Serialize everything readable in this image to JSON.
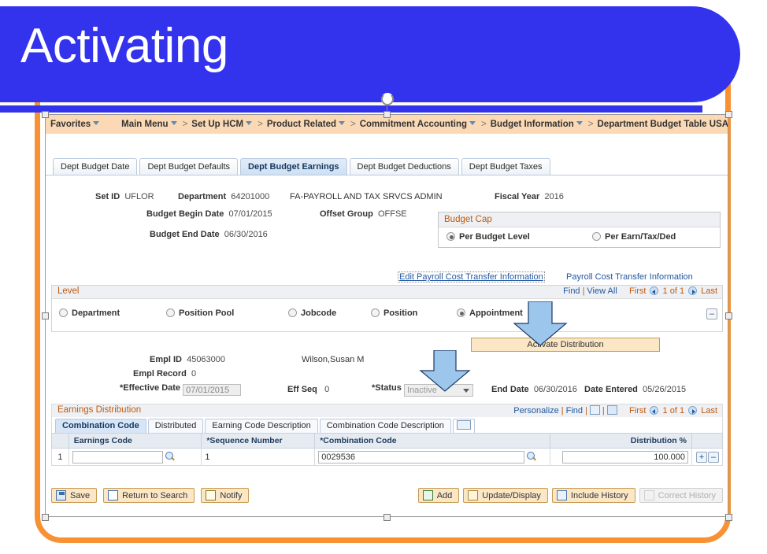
{
  "slide": {
    "title": "Activating",
    "banner_color": "#3333EE",
    "frame_color": "#F79134"
  },
  "breadcrumb": {
    "favorites": "Favorites",
    "items": [
      {
        "label": "Main Menu",
        "has_caret": true
      },
      {
        "label": "Set Up HCM",
        "has_caret": true
      },
      {
        "label": "Product Related",
        "has_caret": true
      },
      {
        "label": "Commitment Accounting",
        "has_caret": true
      },
      {
        "label": "Budget Information",
        "has_caret": true
      },
      {
        "label": "Department Budget Table USA",
        "has_caret": false
      }
    ]
  },
  "tabs": [
    {
      "label": "Dept Budget Date",
      "active": false
    },
    {
      "label": "Dept Budget Defaults",
      "active": false
    },
    {
      "label": "Dept Budget Earnings",
      "active": true
    },
    {
      "label": "Dept Budget Deductions",
      "active": false
    },
    {
      "label": "Dept Budget Taxes",
      "active": false
    }
  ],
  "header": {
    "set_id_label": "Set ID",
    "set_id_value": "UFLOR",
    "department_label": "Department",
    "department_value": "64201000",
    "department_name": "FA-PAYROLL AND TAX SRVCS ADMIN",
    "fiscal_year_label": "Fiscal Year",
    "fiscal_year_value": "2016",
    "budget_begin_label": "Budget Begin Date",
    "budget_begin_value": "07/01/2015",
    "offset_group_label": "Offset Group",
    "offset_group_value": "OFFSE",
    "budget_end_label": "Budget End Date",
    "budget_end_value": "06/30/2016"
  },
  "budget_cap": {
    "title": "Budget Cap",
    "options": [
      {
        "label": "Per Budget Level",
        "selected": true
      },
      {
        "label": "Per Earn/Tax/Ded",
        "selected": false
      }
    ]
  },
  "links": {
    "edit_payroll_cost_transfer": "Edit Payroll Cost Transfer Information",
    "payroll_cost_transfer": "Payroll Cost Transfer Information"
  },
  "level": {
    "title": "Level",
    "nav": {
      "find": "Find",
      "view_all": "View All",
      "first": "First",
      "counter": "1 of 1",
      "last": "Last"
    },
    "options": [
      {
        "label": "Department",
        "selected": false
      },
      {
        "label": "Position Pool",
        "selected": false
      },
      {
        "label": "Jobcode",
        "selected": false
      },
      {
        "label": "Position",
        "selected": false
      },
      {
        "label": "Appointment",
        "selected": true
      }
    ],
    "collapse_glyph": "–"
  },
  "activate_button": {
    "label": "Activate Distribution"
  },
  "employee": {
    "empl_id_label": "Empl ID",
    "empl_id_value": "45063000",
    "name": "Wilson,Susan M",
    "empl_record_label": "Empl Record",
    "empl_record_value": "0",
    "effective_date_label": "*Effective Date",
    "effective_date_value": "07/01/2015",
    "eff_seq_label": "Eff Seq",
    "eff_seq_value": "0",
    "status_label": "*Status",
    "status_value": "Inactive",
    "end_date_label": "End Date",
    "end_date_value": "06/30/2016",
    "date_entered_label": "Date Entered",
    "date_entered_value": "05/26/2015"
  },
  "earnings_distribution": {
    "title": "Earnings Distribution",
    "nav": {
      "personalize": "Personalize",
      "find": "Find",
      "first": "First",
      "counter": "1 of 1",
      "last": "Last"
    },
    "tabs": [
      {
        "label": "Combination Code",
        "active": true
      },
      {
        "label": "Distributed",
        "active": false
      },
      {
        "label": "Earning Code Description",
        "active": false
      },
      {
        "label": "Combination Code Description",
        "active": false
      }
    ],
    "columns": [
      "Earnings Code",
      "*Sequence Number",
      "*Combination Code",
      "Distribution %"
    ],
    "rows": [
      {
        "index": "1",
        "earnings_code": "",
        "sequence_number": "1",
        "combination_code": "0029536",
        "distribution_pct": "100.000",
        "add_glyph": "+",
        "remove_glyph": "–"
      }
    ]
  },
  "toolbar": {
    "left": [
      {
        "label": "Save",
        "icon": "save-icon",
        "disabled": false
      },
      {
        "label": "Return to Search",
        "icon": "search-icon",
        "disabled": false
      },
      {
        "label": "Notify",
        "icon": "notify-icon",
        "disabled": false
      }
    ],
    "right": [
      {
        "label": "Add",
        "icon": "add-icon",
        "disabled": false
      },
      {
        "label": "Update/Display",
        "icon": "pencil-icon",
        "disabled": false
      },
      {
        "label": "Include History",
        "icon": "history-icon",
        "disabled": false
      },
      {
        "label": "Correct History",
        "icon": "correct-history-icon",
        "disabled": true
      }
    ]
  },
  "annotations": {
    "arrow_color": "#9DC6EC",
    "arrows": [
      {
        "name": "arrow-to-activate-distribution"
      },
      {
        "name": "arrow-to-status-field"
      }
    ]
  }
}
